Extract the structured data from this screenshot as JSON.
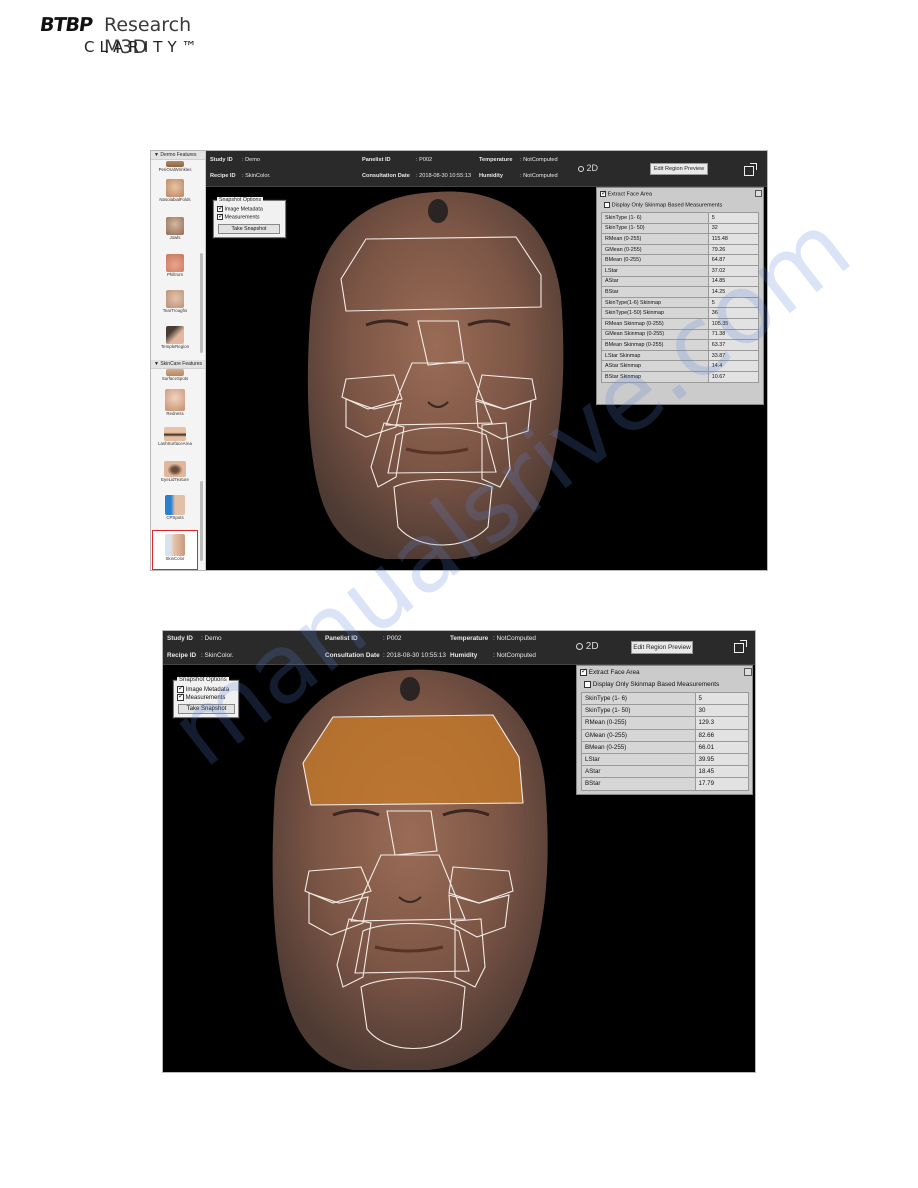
{
  "logo": {
    "mark_text": "BTBP",
    "line1": "Research M3D",
    "line2": "CLARITY™"
  },
  "watermark": {
    "text": "manualsrive.com"
  },
  "screens": [
    {
      "sidebar": {
        "dermo_header": "Dermo Features",
        "dermo_items": [
          {
            "label": "PeriOralWrinkles",
            "icon": "perioral-wrinkles-thumbnail"
          },
          {
            "label": "NasolabialFolds",
            "icon": "nasolabial-folds-thumbnail"
          },
          {
            "label": "Jowls",
            "icon": "jowls-thumbnail"
          },
          {
            "label": "Philtrum",
            "icon": "philtrum-thumbnail"
          },
          {
            "label": "TearTroughs",
            "icon": "tear-troughs-thumbnail"
          },
          {
            "label": "TempleRegion",
            "icon": "temple-region-thumbnail"
          }
        ],
        "skincare_header": "SkinCare Features",
        "skincare_items": [
          {
            "label": "SurfaceSpots",
            "icon": "surface-spots-thumbnail"
          },
          {
            "label": "Redness",
            "icon": "redness-thumbnail"
          },
          {
            "label": "LashSurfaceArea",
            "icon": "lash-surface-area-thumbnail"
          },
          {
            "label": "EyeLidTexture",
            "icon": "eyelid-texture-thumbnail"
          },
          {
            "label": "CPSpots",
            "icon": "cp-spots-thumbnail"
          },
          {
            "label": "SkinColor",
            "icon": "skin-color-thumbnail",
            "selected": true
          }
        ]
      },
      "header": {
        "study_label": "Study ID",
        "study_value": ": Demo",
        "recipe_label": "Recipe ID",
        "recipe_value": ": SkinColor.",
        "panelist_label": "Panelist ID",
        "panelist_value": ": P002",
        "consult_label": "Consultation Date",
        "consult_value": ": 2018-08-30 10:55:13",
        "temp_label": "Temperature",
        "temp_value": ": NotComputed",
        "humidity_label": "Humidity",
        "humidity_value": ": NotComputed",
        "mode_label": "2D",
        "edit_button": "Edit Region Preview"
      },
      "snapshot": {
        "title": "Snapshot Options",
        "opt1": "Image Metadata",
        "opt2": "Measurements",
        "button": "Take Snapshot"
      },
      "panel": {
        "extract_label": "Extract Face Area",
        "display_only_label": "Display Only Skinmap Based Measurements",
        "rows": [
          {
            "name": "SkinType (1- 6)",
            "value": "5"
          },
          {
            "name": "SkinType (1- 50)",
            "value": "32"
          },
          {
            "name": "RMean (0-255)",
            "value": "115.48"
          },
          {
            "name": "GMean (0-255)",
            "value": "79.26"
          },
          {
            "name": "BMean (0-255)",
            "value": "64.87"
          },
          {
            "name": "LStar",
            "value": "37.02"
          },
          {
            "name": "AStar",
            "value": "14.85"
          },
          {
            "name": "BStar",
            "value": "14.25"
          },
          {
            "name": "SkinType(1-6) Skinmap",
            "value": "5"
          },
          {
            "name": "SkinType(1-50) Skinmap",
            "value": "36"
          },
          {
            "name": "RMean Skinmap (0-255)",
            "value": "105.35"
          },
          {
            "name": "GMean Skinmap (0-255)",
            "value": "71.38"
          },
          {
            "name": "BMean Skinmap (0-255)",
            "value": "63.37"
          },
          {
            "name": "LStar Skinmap",
            "value": "33.87"
          },
          {
            "name": "AStar Skinmap",
            "value": "14.4"
          },
          {
            "name": "BStar Skinmap",
            "value": "10.67"
          }
        ]
      }
    },
    {
      "header": {
        "study_label": "Study ID",
        "study_value": ": Demo",
        "recipe_label": "Recipe ID",
        "recipe_value": ": SkinColor.",
        "panelist_label": "Panelist ID",
        "panelist_value": ": P002",
        "consult_label": "Consultation Date",
        "consult_value": ": 2018-08-30 10:55:13",
        "temp_label": "Temperature",
        "temp_value": ": NotComputed",
        "humidity_label": "Humidity",
        "humidity_value": ": NotComputed",
        "mode_label": "2D",
        "edit_button": "Edit Region Preview"
      },
      "snapshot": {
        "title": "Snapshot Options",
        "opt1": "Image Metadata",
        "opt2": "Measurements",
        "button": "Take Snapshot"
      },
      "panel": {
        "extract_label": "Extract Face Area",
        "display_only_label": "Display Only Skinmap Based Measurements",
        "rows": [
          {
            "name": "SkinType (1- 6)",
            "value": "5"
          },
          {
            "name": "SkinType (1- 50)",
            "value": "30"
          },
          {
            "name": "RMean (0-255)",
            "value": "129.3"
          },
          {
            "name": "GMean (0-255)",
            "value": "82.66"
          },
          {
            "name": "BMean (0-255)",
            "value": "66.01"
          },
          {
            "name": "LStar",
            "value": "39.95"
          },
          {
            "name": "AStar",
            "value": "18.45"
          },
          {
            "name": "BStar",
            "value": "17.79"
          }
        ]
      }
    }
  ]
}
